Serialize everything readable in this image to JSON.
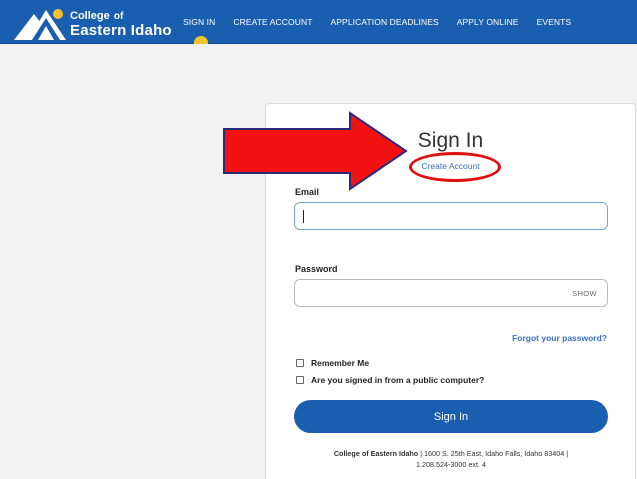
{
  "header": {
    "logo_line1": "College",
    "logo_of": "of",
    "logo_line2": "Eastern Idaho",
    "nav": [
      "SIGN IN",
      "CREATE ACCOUNT",
      "APPLICATION DEADLINES",
      "APPLY ONLINE",
      "EVENTS"
    ]
  },
  "form": {
    "title": "Sign In",
    "create_account": "Create Account",
    "email_label": "Email",
    "email_value": "",
    "password_label": "Password",
    "show_label": "SHOW",
    "forgot": "Forgot your password?",
    "remember_me": "Remember Me",
    "public_computer": "Are you signed in from a public computer?",
    "submit": "Sign In"
  },
  "footer": {
    "org": "College of Eastern Idaho",
    "address": " | 1600 S. 25th East, Idaho Falls, Idaho 83404 |",
    "phone": "1.208.524-3000 ext. 4"
  },
  "colors": {
    "brand_blue": "#1a5faf",
    "accent_yellow": "#f4c32c",
    "annotation_red": "#e01010",
    "link_blue": "#3b6fc0"
  }
}
